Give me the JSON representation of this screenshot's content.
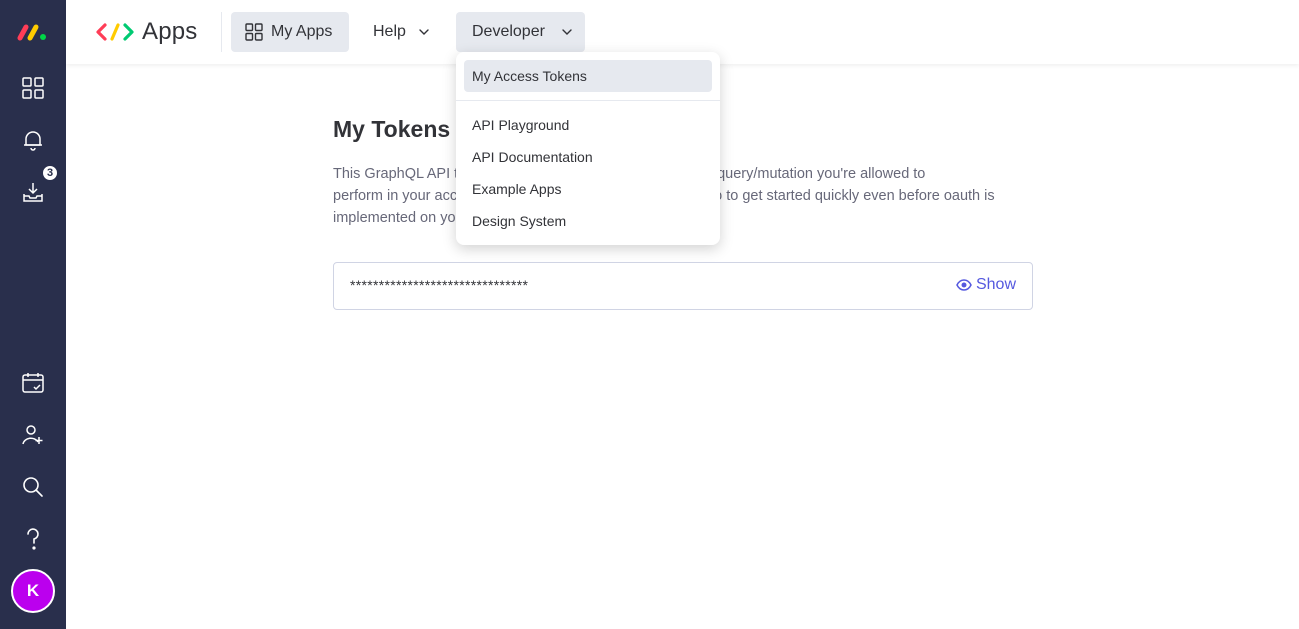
{
  "header": {
    "brand_title": "Apps",
    "nav": {
      "my_apps": "My Apps",
      "help": "Help",
      "developer": "Developer"
    }
  },
  "sidebar": {
    "logo_icon": "monday-logo-icon",
    "icons": [
      "grid-icon",
      "bell-icon",
      "inbox-download-icon",
      "calendar-check-icon",
      "add-user-icon",
      "search-icon",
      "question-icon"
    ],
    "inbox_badge": "3",
    "avatar_initial": "K",
    "avatar_color": "#bb00ee"
  },
  "main": {
    "title": "My Tokens",
    "description_line1_a": "This GraphQL API t",
    "description_line1_b": "s to every query/mutation you're allowed to",
    "description_line2_a": "perform in your acc",
    "description_line2_b": "o to get started quickly even before oauth is",
    "description_line3_a": "implemented on yo",
    "token_value": "*******************************",
    "show_label": "Show"
  },
  "dropdown": {
    "items": [
      {
        "label": "My Access Tokens",
        "active": true
      },
      {
        "label": "API Playground"
      },
      {
        "label": "API Documentation"
      },
      {
        "label": "Example Apps"
      },
      {
        "label": "Design System"
      }
    ]
  },
  "colors": {
    "sidebar_bg": "#292f4c",
    "accent": "#5559df",
    "nav_active_bg": "#e6e9ef"
  }
}
